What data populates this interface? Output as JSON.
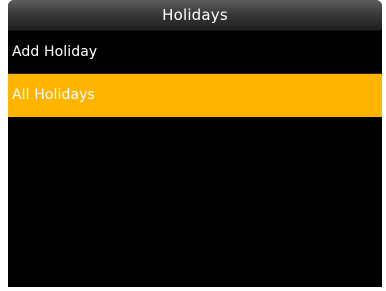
{
  "screen": {
    "title": "Holidays"
  },
  "menu": {
    "items": [
      {
        "label": "Add Holiday",
        "selected": false
      },
      {
        "label": "All Holidays",
        "selected": true
      }
    ]
  },
  "colors": {
    "background": "#000000",
    "selection": "#ffb400",
    "text": "#ffffff"
  }
}
